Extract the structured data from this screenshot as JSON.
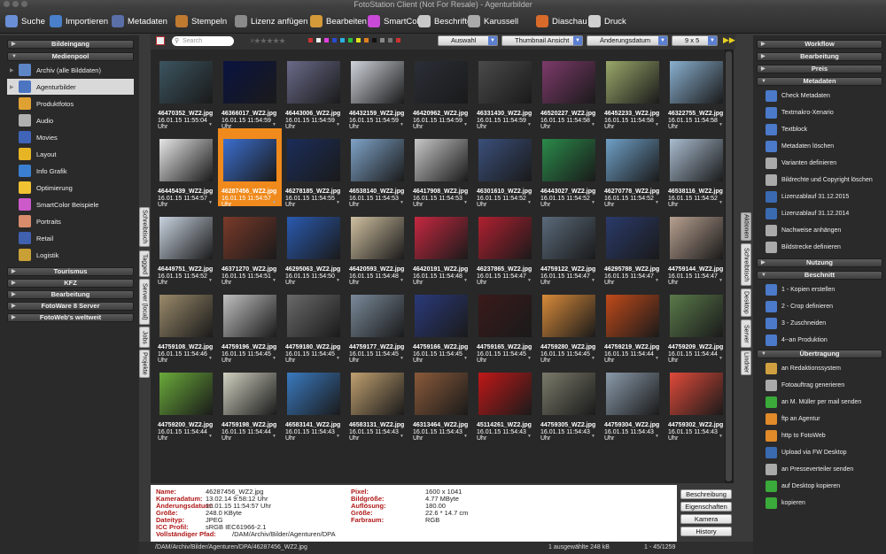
{
  "window": {
    "title": "FotoStation Client (Not For Resale) - Agenturbilder"
  },
  "toolbar": [
    {
      "label": "Suche",
      "icon": "search-icon",
      "color": "#6b8fd6"
    },
    {
      "label": "Importieren",
      "icon": "import-icon",
      "color": "#4a7fc9"
    },
    {
      "label": "Metadaten",
      "icon": "metadata-icon",
      "color": "#5a6fa8"
    },
    {
      "label": "Stempeln",
      "icon": "stamp-icon",
      "color": "#c07a30"
    },
    {
      "label": "Lizenz anfügen",
      "icon": "license-icon",
      "color": "#8a8a8a"
    },
    {
      "label": "Bearbeiten",
      "icon": "palette-icon",
      "color": "#d49a3a"
    },
    {
      "label": "SmartColor",
      "icon": "smartcolor-icon",
      "color": "#c94ad6"
    },
    {
      "label": "Beschriften",
      "icon": "scissors-icon",
      "color": "#c9c9c9"
    },
    {
      "label": "Karussell",
      "icon": "carousel-icon",
      "color": "#aaaaaa"
    },
    {
      "label": "Diaschau",
      "icon": "slideshow-icon",
      "color": "#d86a2a"
    },
    {
      "label": "Druck",
      "icon": "print-icon",
      "color": "#cfcfcf"
    }
  ],
  "left": {
    "headers_top": [
      "Bildeingang",
      "Medienpool"
    ],
    "items": [
      {
        "label": "Archiv (alle Bilddaten)",
        "color": "#5d86c7"
      },
      {
        "label": "Agenturbilder",
        "color": "#4b74c1"
      },
      {
        "label": "Produktfotos",
        "color": "#e0a133"
      },
      {
        "label": "Audio",
        "color": "#b0b0b0"
      },
      {
        "label": "Movies",
        "color": "#3f64b8"
      },
      {
        "label": "Layout",
        "color": "#e7b524"
      },
      {
        "label": "Info Grafik",
        "color": "#3a7fd0"
      },
      {
        "label": "Optimierung",
        "color": "#f1c232"
      },
      {
        "label": "SmartColor Beispiele",
        "color": "#cc5acb"
      },
      {
        "label": "Portraits",
        "color": "#d98c6c"
      },
      {
        "label": "Retail",
        "color": "#4060b0"
      },
      {
        "label": "Logistik",
        "color": "#c9a036"
      }
    ],
    "headers_bottom": [
      "Tourismus",
      "KFZ",
      "Bearbeitung",
      "FotoWare 8 Server",
      "FotoWeb's weltweit"
    ],
    "vtabs": [
      "Schreibtisch",
      "Tagged",
      "Server (local)",
      "Jobs",
      "Projekte"
    ]
  },
  "filterbar": {
    "search_placeholder": "Search",
    "select1": "Auswahl",
    "select2": "Thumbnail Ansicht",
    "select3": "Änderungsdatum",
    "select4": "9 x 5"
  },
  "grid": [
    {
      "name": "46470352_WZ2.jpg",
      "date": "16.01.15 11:55:04 Uhr",
      "color": "#3c5560"
    },
    {
      "name": "46366017_WZ2.jpg",
      "date": "16.01.15 11:54:59 Uhr",
      "color": "#0a1340"
    },
    {
      "name": "46443006_WZ2.jpg",
      "date": "16.01.15 11:54:59 Uhr",
      "color": "#6a6a8a"
    },
    {
      "name": "46432159_WZ2.jpg",
      "date": "16.01.15 11:54:59 Uhr",
      "color": "#cfd3da"
    },
    {
      "name": "46420962_WZ2.jpg",
      "date": "16.01.15 11:54:59 Uhr",
      "color": "#2a2e36"
    },
    {
      "name": "46331430_WZ2.jpg",
      "date": "16.01.15 11:54:59 Uhr",
      "color": "#4a4a4a"
    },
    {
      "name": "46520227_WZ2.jpg",
      "date": "16.01.15 11:54:58 Uhr",
      "color": "#7d3a6a"
    },
    {
      "name": "46452233_WZ2.jpg",
      "date": "16.01.15 11:54:58 Uhr",
      "color": "#9aa86a"
    },
    {
      "name": "46322755_WZ2.jpg",
      "date": "16.01.15 11:54:58 Uhr",
      "color": "#8ab0d0"
    },
    {
      "name": "46445439_WZ2.jpg",
      "date": "16.01.15 11:54:57 Uhr",
      "color": "#e6e6e6"
    },
    {
      "name": "46287456_WZ2.jpg",
      "date": "16.01.15 11:54:57 Uhr",
      "color": "#3b6fd0"
    },
    {
      "name": "46278185_WZ2.jpg",
      "date": "16.01.15 11:54:55 Uhr",
      "color": "#1b2d5a"
    },
    {
      "name": "46538140_WZ2.jpg",
      "date": "16.01.15 11:54:53 Uhr",
      "color": "#7fa3c8"
    },
    {
      "name": "46417908_WZ2.jpg",
      "date": "16.01.15 11:54:53 Uhr",
      "color": "#c7c7c7"
    },
    {
      "name": "46301610_WZ2.jpg",
      "date": "16.01.15 11:54:52 Uhr",
      "color": "#3a4f7a"
    },
    {
      "name": "46443027_WZ2.jpg",
      "date": "16.01.15 11:54:52 Uhr",
      "color": "#2a8a4a"
    },
    {
      "name": "46270778_WZ2.jpg",
      "date": "16.01.15 11:54:52 Uhr",
      "color": "#6fa0c7"
    },
    {
      "name": "46538116_WZ2.jpg",
      "date": "16.01.15 11:54:52 Uhr",
      "color": "#a9bcd0"
    },
    {
      "name": "46449751_WZ2.jpg",
      "date": "16.01.15 11:54:52 Uhr",
      "color": "#c8d3e0"
    },
    {
      "name": "46371270_WZ2.jpg",
      "date": "16.01.15 11:54:51 Uhr",
      "color": "#7a3a2a"
    },
    {
      "name": "46295063_WZ2.jpg",
      "date": "16.01.15 11:54:50 Uhr",
      "color": "#2a5ab0"
    },
    {
      "name": "46420593_WZ2.jpg",
      "date": "16.01.15 11:54:48 Uhr",
      "color": "#d0c0a0"
    },
    {
      "name": "46420191_WZ2.jpg",
      "date": "16.01.15 11:54:48 Uhr",
      "color": "#c62840"
    },
    {
      "name": "46237865_WZ2.jpg",
      "date": "16.01.15 11:54:47 Uhr",
      "color": "#b02030"
    },
    {
      "name": "44759122_WZ2.jpg",
      "date": "16.01.15 11:54:47 Uhr",
      "color": "#5a6a7a"
    },
    {
      "name": "46295788_WZ2.jpg",
      "date": "16.01.15 11:54:47 Uhr",
      "color": "#2a3a6a"
    },
    {
      "name": "44759144_WZ2.jpg",
      "date": "16.01.15 11:54:47 Uhr",
      "color": "#b8a090"
    },
    {
      "name": "44759108_WZ2.jpg",
      "date": "16.01.15 11:54:46 Uhr",
      "color": "#9a8a6a"
    },
    {
      "name": "44759196_WZ2.jpg",
      "date": "16.01.15 11:54:45 Uhr",
      "color": "#c0c0c0"
    },
    {
      "name": "44759180_WZ2.jpg",
      "date": "16.01.15 11:54:45 Uhr",
      "color": "#6a6a6a"
    },
    {
      "name": "44759177_WZ2.jpg",
      "date": "16.01.15 11:54:45 Uhr",
      "color": "#7a8a9a"
    },
    {
      "name": "44759166_WZ2.jpg",
      "date": "16.01.15 11:54:45 Uhr",
      "color": "#2a3a7a"
    },
    {
      "name": "44759165_WZ2.jpg",
      "date": "16.01.15 11:54:45 Uhr",
      "color": "#3a1a1a"
    },
    {
      "name": "44759280_WZ2.jpg",
      "date": "16.01.15 11:54:45 Uhr",
      "color": "#d88a3a"
    },
    {
      "name": "44759219_WZ2.jpg",
      "date": "16.01.15 11:54:44 Uhr",
      "color": "#c04a1a"
    },
    {
      "name": "44759209_WZ2.jpg",
      "date": "16.01.15 11:54:44 Uhr",
      "color": "#5a7a4a"
    },
    {
      "name": "44759200_WZ2.jpg",
      "date": "16.01.15 11:54:44 Uhr",
      "color": "#6aaa3a"
    },
    {
      "name": "44759198_WZ2.jpg",
      "date": "16.01.15 11:54:44 Uhr",
      "color": "#d0d0c0"
    },
    {
      "name": "46583141_WZ2.jpg",
      "date": "16.01.15 11:54:43 Uhr",
      "color": "#3a7ac0"
    },
    {
      "name": "46583131_WZ2.jpg",
      "date": "16.01.15 11:54:43 Uhr",
      "color": "#c0a070"
    },
    {
      "name": "46313464_WZ2.jpg",
      "date": "16.01.15 11:54:43 Uhr",
      "color": "#8a5a3a"
    },
    {
      "name": "45114261_WZ2.jpg",
      "date": "16.01.15 11:54:43 Uhr",
      "color": "#c01818"
    },
    {
      "name": "44759305_WZ2.jpg",
      "date": "16.01.15 11:54:43 Uhr",
      "color": "#7a7a6a"
    },
    {
      "name": "44759304_WZ2.jpg",
      "date": "16.01.15 11:54:43 Uhr",
      "color": "#8a9aaa"
    },
    {
      "name": "44759302_WZ2.jpg",
      "date": "16.01.15 11:54:43 Uhr",
      "color": "#e04a3a"
    }
  ],
  "selected_index": 10,
  "info": {
    "left": [
      {
        "k": "Name:",
        "v": "46287456_WZ2.jpg"
      },
      {
        "k": "Kameradatum:",
        "v": "13.02.14 9:58:12 Uhr"
      },
      {
        "k": "Änderungsdatum:",
        "v": "16.01.15 11:54:57 Uhr"
      },
      {
        "k": "Größe:",
        "v": "248.0 KByte"
      },
      {
        "k": "Dateityp:",
        "v": "JPEG"
      },
      {
        "k": "ICC Profil:",
        "v": "sRGB IEC61966-2.1"
      },
      {
        "k": "Vollständiger Pfad:",
        "v": "/DAM/Archiv/Bilder/Agenturen/DPA"
      }
    ],
    "right": [
      {
        "k": "Pixel:",
        "v": "1600 x 1041"
      },
      {
        "k": "Bildgröße:",
        "v": "4.77 MByte"
      },
      {
        "k": "Auflösung:",
        "v": "180.00"
      },
      {
        "k": "Größe:",
        "v": "22.6 * 14.7 cm"
      },
      {
        "k": "Farbraum:",
        "v": "RGB"
      }
    ],
    "buttons": [
      "Beschreibung",
      "Eigenschaften",
      "Kamera",
      "History"
    ]
  },
  "status": {
    "path": "/DAM/Archiv/Bilder/Agenturen/DPA/46287456_WZ2.jpg",
    "selection": "1 ausgewählte  248 kB",
    "range": "1 - 45/1259"
  },
  "right": {
    "sections": [
      {
        "title": "Workflow",
        "items": []
      },
      {
        "title": "Bearbeitung",
        "items": []
      },
      {
        "title": "Preis",
        "items": []
      },
      {
        "title": "Metadaten",
        "items": [
          {
            "label": "Check Metadaten",
            "color": "#4a7ac9"
          },
          {
            "label": "Textmakro-Xenario",
            "color": "#4a7ac9"
          },
          {
            "label": "Textblock",
            "color": "#4a7ac9"
          },
          {
            "label": "Metadaten löschen",
            "color": "#4a7ac9"
          },
          {
            "label": "Varianten definieren",
            "color": "#aaaaaa"
          },
          {
            "label": "Bildrechte und Copyright löschen",
            "color": "#aaaaaa"
          },
          {
            "label": "Lizenzablauf 31.12.2015",
            "color": "#3a6ab0"
          },
          {
            "label": "Lizenzablauf 31.12.2014",
            "color": "#3a6ab0"
          },
          {
            "label": "Nachweise anhängen",
            "color": "#aaaaaa"
          },
          {
            "label": "Bildstrecke definieren",
            "color": "#aaaaaa"
          }
        ]
      },
      {
        "title": "Nutzung",
        "items": []
      },
      {
        "title": "Beschnitt",
        "items": [
          {
            "label": "1 - Kopien erstellen",
            "color": "#4a7ac9"
          },
          {
            "label": "2 - Crop definieren",
            "color": "#4a7ac9"
          },
          {
            "label": "3 - Zuschneiden",
            "color": "#4a7ac9"
          },
          {
            "label": "4--an Produktion",
            "color": "#4a7ac9"
          }
        ]
      },
      {
        "title": "Übertragung",
        "items": [
          {
            "label": "an Redaktionssystem",
            "color": "#d0a040"
          },
          {
            "label": "Fotoauftrag generieren",
            "color": "#aaaaaa"
          },
          {
            "label": "an M. Müller per mail senden",
            "color": "#3aaa3a"
          },
          {
            "label": "ftp an Agentur",
            "color": "#e08a2a"
          },
          {
            "label": "http to FotoWeb",
            "color": "#e08a2a"
          },
          {
            "label": "Upload via FW Desktop",
            "color": "#3a6ab0"
          },
          {
            "label": "an Presseverteiler senden",
            "color": "#aaaaaa"
          },
          {
            "label": "auf Desktop kopieren",
            "color": "#3aaa3a"
          },
          {
            "label": "kopieren",
            "color": "#3aaa3a"
          }
        ]
      }
    ],
    "vtabs": [
      "Aktionen",
      "Schreibtisch",
      "Desktop",
      "Server",
      "Lindner"
    ]
  }
}
